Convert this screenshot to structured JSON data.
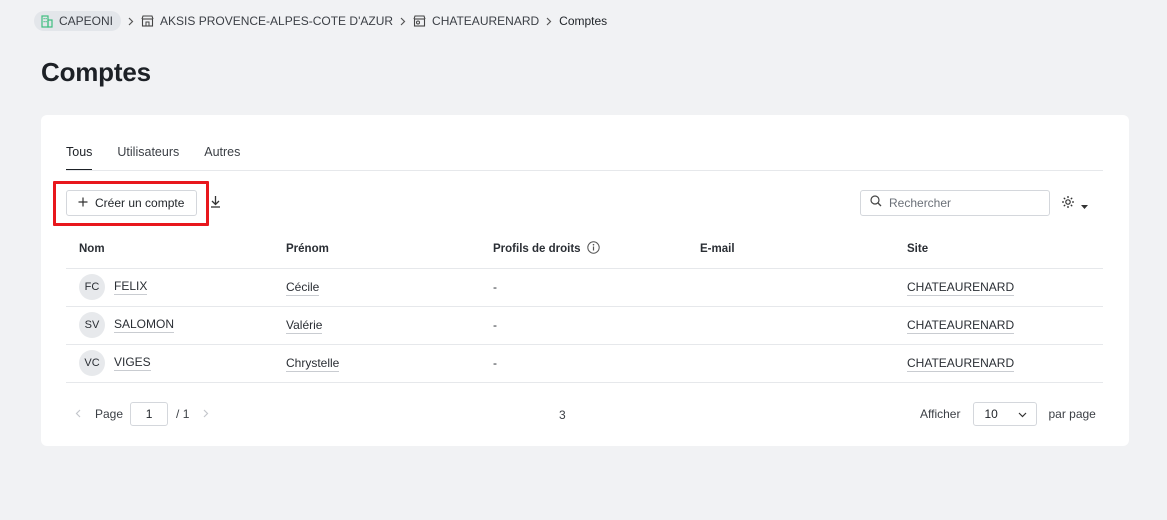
{
  "breadcrumb": {
    "items": [
      {
        "label": "CAPEONI",
        "icon": "building-icon"
      },
      {
        "label": "AKSIS PROVENCE-ALPES-COTE D'AZUR",
        "icon": "store-icon"
      },
      {
        "label": "CHATEAURENARD",
        "icon": "site-icon"
      },
      {
        "label": "Comptes"
      }
    ]
  },
  "page": {
    "title": "Comptes"
  },
  "tabs": [
    {
      "label": "Tous",
      "active": true
    },
    {
      "label": "Utilisateurs",
      "active": false
    },
    {
      "label": "Autres",
      "active": false
    }
  ],
  "toolbar": {
    "create_label": "Créer un compte",
    "search_placeholder": "Rechercher"
  },
  "table": {
    "columns": [
      "Nom",
      "Prénom",
      "Profils de droits",
      "E-mail",
      "Site"
    ],
    "rows": [
      {
        "initials": "FC",
        "nom": "FELIX",
        "prenom": "Cécile",
        "profils": "-",
        "email": "",
        "site": "CHATEAURENARD"
      },
      {
        "initials": "SV",
        "nom": "SALOMON",
        "prenom": "Valérie",
        "profils": "-",
        "email": "",
        "site": "CHATEAURENARD"
      },
      {
        "initials": "VC",
        "nom": "VIGES",
        "prenom": "Chrystelle",
        "profils": "-",
        "email": "",
        "site": "CHATEAURENARD"
      }
    ]
  },
  "pagination": {
    "page_label": "Page",
    "current_page": "1",
    "of_label": "/ 1",
    "total": "3",
    "show_label": "Afficher",
    "page_size": "10",
    "per_page_label": "par page"
  },
  "colors": {
    "highlight": "#e8171d",
    "building_icon": "#3fbf7f",
    "background": "#f1f2f4"
  }
}
